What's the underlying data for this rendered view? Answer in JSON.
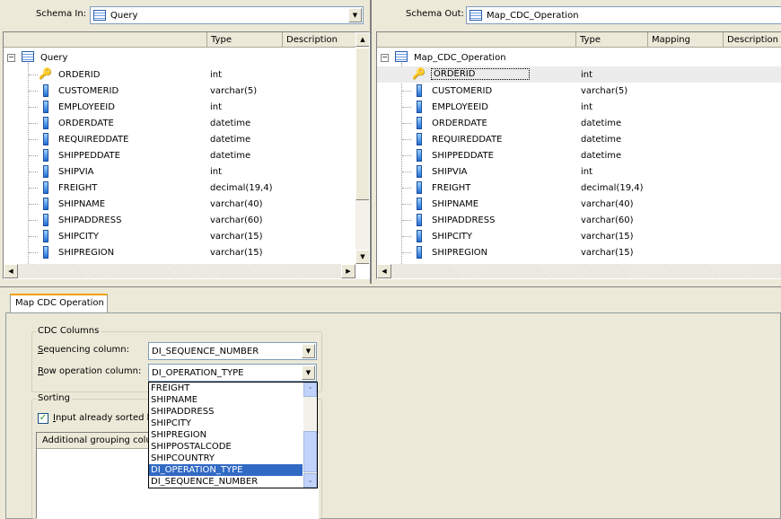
{
  "schema_in": {
    "label": "Schema In:",
    "value": "Query",
    "tree_root": "Query",
    "columns": [
      "",
      "Type",
      "Description"
    ]
  },
  "schema_out": {
    "label": "Schema Out:",
    "value": "Map_CDC_Operation",
    "tree_root": "Map_CDC_Operation",
    "columns": [
      "",
      "Type",
      "Mapping",
      "Description"
    ]
  },
  "fields": [
    {
      "name": "ORDERID",
      "type": "int",
      "key": true
    },
    {
      "name": "CUSTOMERID",
      "type": "varchar(5)"
    },
    {
      "name": "EMPLOYEEID",
      "type": "int"
    },
    {
      "name": "ORDERDATE",
      "type": "datetime"
    },
    {
      "name": "REQUIREDDATE",
      "type": "datetime"
    },
    {
      "name": "SHIPPEDDATE",
      "type": "datetime"
    },
    {
      "name": "SHIPVIA",
      "type": "int"
    },
    {
      "name": "FREIGHT",
      "type": "decimal(19,4)"
    },
    {
      "name": "SHIPNAME",
      "type": "varchar(40)"
    },
    {
      "name": "SHIPADDRESS",
      "type": "varchar(60)"
    },
    {
      "name": "SHIPCITY",
      "type": "varchar(15)"
    },
    {
      "name": "SHIPREGION",
      "type": "varchar(15)"
    }
  ],
  "tab": {
    "label": "Map CDC Operation"
  },
  "cdc": {
    "title": "CDC Columns",
    "seq_label_u": "S",
    "seq_label_rest": "equencing column:",
    "seq_value": "DI_SEQUENCE_NUMBER",
    "row_label_u": "R",
    "row_label_rest": "ow operation column:",
    "row_value": "DI_OPERATION_TYPE"
  },
  "sorting": {
    "title": "Sorting",
    "checkbox_u": "I",
    "checkbox_rest": "nput already sorted b",
    "checked": true,
    "grouping_header": "Additional grouping colum"
  },
  "dropdown": {
    "items": [
      "FREIGHT",
      "SHIPNAME",
      "SHIPADDRESS",
      "SHIPCITY",
      "SHIPREGION",
      "SHIPPOSTALCODE",
      "SHIPCOUNTRY",
      "DI_OPERATION_TYPE",
      "DI_SEQUENCE_NUMBER"
    ],
    "selected": "DI_OPERATION_TYPE"
  }
}
